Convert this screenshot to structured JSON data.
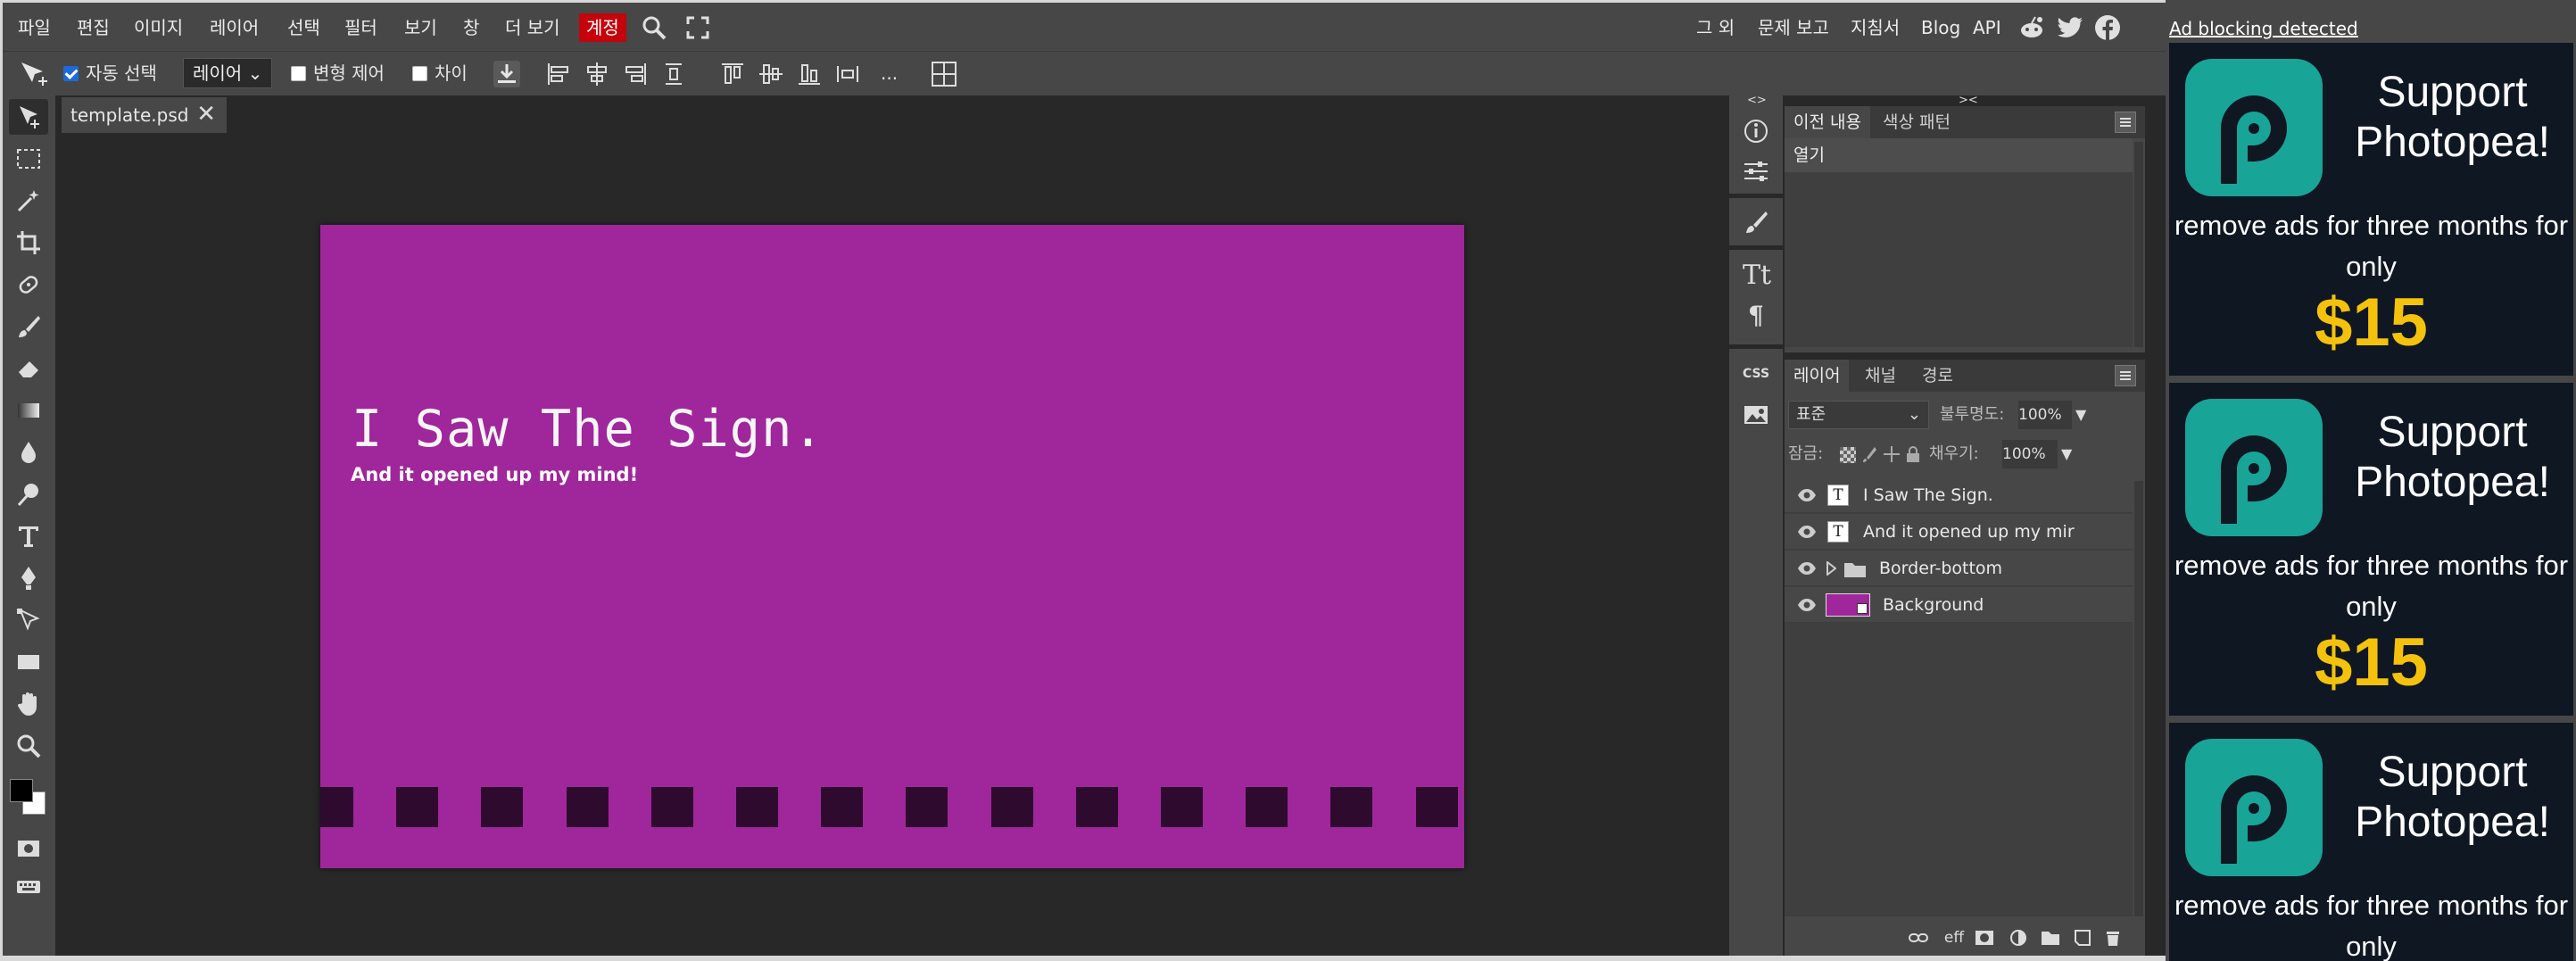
{
  "menubar": {
    "items": [
      "파일",
      "편집",
      "이미지",
      "레이어",
      "선택",
      "필터",
      "보기",
      "창",
      "더 보기",
      "계정"
    ],
    "right_links": [
      "그 외",
      "문제 보고",
      "지침서",
      "Blog",
      "API"
    ]
  },
  "options": {
    "auto_select_label": "자동 선택",
    "auto_select_checked": true,
    "target_select": "레이어",
    "transform_label": "변형 제어",
    "transform_checked": false,
    "distance_label": "차이",
    "distance_checked": false,
    "more": "..."
  },
  "document": {
    "tab_name": "template.psd",
    "close_glyph": "✕"
  },
  "canvas": {
    "background_color": "#a0269b",
    "title_text": "I Saw The Sign.",
    "subtitle_text": "And it opened up my mind!",
    "border_square_color": "#2e0b2e",
    "border_square_count": 14
  },
  "panel_toggles": {
    "left": "<>",
    "right": "><"
  },
  "iconbar": {
    "css_label": "CSS"
  },
  "history_panel": {
    "tabs": [
      "이전 내용",
      "색상 패턴"
    ],
    "items": [
      "열기"
    ]
  },
  "layers_panel": {
    "tabs": [
      "레이어",
      "채널",
      "경로"
    ],
    "blend_mode": "표준",
    "opacity_label": "불투명도:",
    "opacity_value": "100%",
    "lock_label": "잠금:",
    "fill_label": "채우기:",
    "fill_value": "100%",
    "layers": [
      {
        "name": "I Saw The Sign.",
        "type": "text"
      },
      {
        "name": "And it opened up my mir",
        "type": "text"
      },
      {
        "name": "Border-bottom",
        "type": "folder"
      },
      {
        "name": "Background",
        "type": "raster"
      }
    ],
    "footer_eff": "eff"
  },
  "ads": {
    "notice": "Ad blocking detected",
    "headline": "Support Photopea!",
    "body": "remove ads for three months for only",
    "price": "$15"
  },
  "colors": {
    "accent_red": "#c4030b",
    "panel_bg": "#474747",
    "workspace_bg": "#282828",
    "ad_teal": "#18a497",
    "ad_gold": "#f4c20d"
  }
}
